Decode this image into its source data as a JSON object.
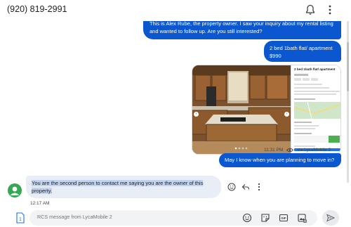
{
  "header": {
    "phone_number": "(920) 819-2991",
    "icons": [
      "bell-icon",
      "more-vert-icon"
    ]
  },
  "messages": {
    "outgoing_1": "This is Alex Rube, the property owner. I saw your inquiry about my rental listing and wanted to follow up. Are you still interested?",
    "outgoing_2": "2 bed 1bath flat/ apartment $990",
    "image_card": {
      "listing_title": "2 bed 1bath flat/ apartment",
      "time": "11:31 PM",
      "via": "via LycaMobile 2"
    },
    "outgoing_3": "May I know when you are planning to move in?",
    "incoming_1": "You are the second person to contact me saying you are the owner of this property.",
    "incoming_time": "12:17 AM"
  },
  "composer": {
    "sim_label": "1",
    "placeholder": "RCS message from LycaMobile 2",
    "icons": [
      "sim-icon",
      "emoji-icon",
      "sticker-icon",
      "gif-icon",
      "attach-media-icon",
      "send-icon"
    ]
  },
  "colors": {
    "outgoing_bubble": "#0b57d0",
    "incoming_bubble": "#e9eef6",
    "highlight": "#c2d3ee",
    "avatar": "#34a853"
  }
}
